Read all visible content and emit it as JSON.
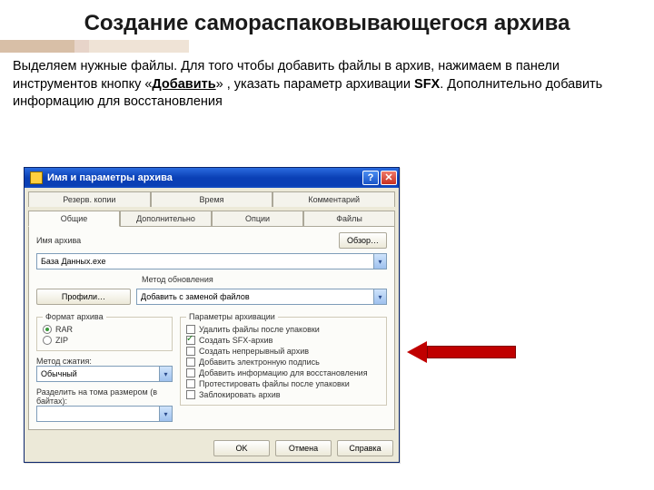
{
  "slide": {
    "title": "Создание самораспаковывающегося архива",
    "desc_parts": {
      "p1": "Выделяем нужные файлы. Для того чтобы добавить файлы в архив, нажимаем в панели инструментов кнопку «",
      "add_btn": "Добавить",
      "p2": "» ,  указать параметр архивации ",
      "sfx": "SFX",
      "p3": ". Дополнительно добавить информацию для восстановления"
    }
  },
  "dialog": {
    "title": "Имя и параметры архива",
    "tabs_row1": [
      "Резерв. копии",
      "Время",
      "Комментарий"
    ],
    "tabs_row2": [
      "Общие",
      "Дополнительно",
      "Опции",
      "Файлы"
    ],
    "active_tab": "Общие",
    "archive_name_label": "Имя архива",
    "archive_name_value": "База Данных.exe",
    "browse_btn": "Обзор…",
    "update_mode_label": "Метод обновления",
    "update_mode_value": "Добавить с заменой файлов",
    "profiles_btn": "Профили…",
    "format_group": "Формат архива",
    "formats": [
      {
        "label": "RAR",
        "on": true
      },
      {
        "label": "ZIP",
        "on": false
      }
    ],
    "method_label": "Метод сжатия:",
    "method_value": "Обычный",
    "split_label": "Разделить на тома размером (в байтах):",
    "split_value": "",
    "params_group": "Параметры архивации",
    "params": [
      {
        "label": "Удалить файлы после упаковки",
        "on": false
      },
      {
        "label": "Создать SFX-архив",
        "on": true
      },
      {
        "label": "Создать непрерывный архив",
        "on": false
      },
      {
        "label": "Добавить электронную подпись",
        "on": false
      },
      {
        "label": "Добавить информацию для восстановления",
        "on": false
      },
      {
        "label": "Протестировать файлы после упаковки",
        "on": false
      },
      {
        "label": "Заблокировать архив",
        "on": false
      }
    ],
    "buttons": {
      "ok": "OK",
      "cancel": "Отмена",
      "help": "Справка"
    }
  }
}
